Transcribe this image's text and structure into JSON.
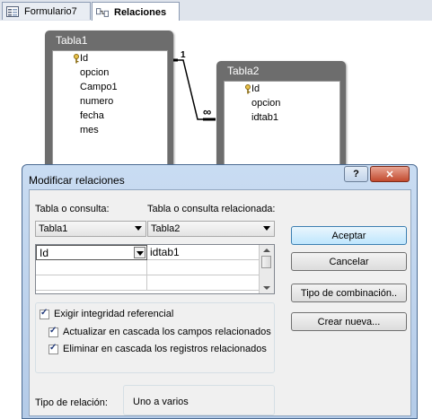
{
  "tabs": [
    {
      "label": "Formulario7",
      "icon": "form-icon"
    },
    {
      "label": "Relaciones",
      "icon": "relationships-icon"
    }
  ],
  "tables": [
    {
      "title": "Tabla1",
      "fields": [
        "Id",
        "opcion",
        "Campo1",
        "numero",
        "fecha",
        "mes"
      ],
      "key_field": "Id"
    },
    {
      "title": "Tabla2",
      "fields": [
        "Id",
        "opcion",
        "idtab1"
      ],
      "key_field": "Id"
    }
  ],
  "relationship_line": {
    "one_label": "1",
    "many_label": "∞"
  },
  "dialog": {
    "title": "Modificar relaciones",
    "help_glyph": "?",
    "close_glyph": "✕",
    "table_label": "Tabla o consulta:",
    "related_table_label": "Tabla o consulta relacionada:",
    "table_value": "Tabla1",
    "related_table_value": "Tabla2",
    "grid_rows": [
      {
        "left": "Id",
        "right": "idtab1"
      },
      {
        "left": "",
        "right": ""
      },
      {
        "left": "",
        "right": ""
      }
    ],
    "options": [
      {
        "label": "Exigir integridad referencial",
        "checked": true
      },
      {
        "label": "Actualizar en cascada los campos relacionados",
        "checked": true
      },
      {
        "label": "Eliminar en cascada los registros relacionados",
        "checked": true
      }
    ],
    "relation_type_label": "Tipo de relación:",
    "relation_type_value": "Uno a varios",
    "buttons": {
      "accept": "Aceptar",
      "cancel": "Cancelar",
      "join_type": "Tipo de combinación..",
      "create_new": "Crear nueva..."
    }
  }
}
